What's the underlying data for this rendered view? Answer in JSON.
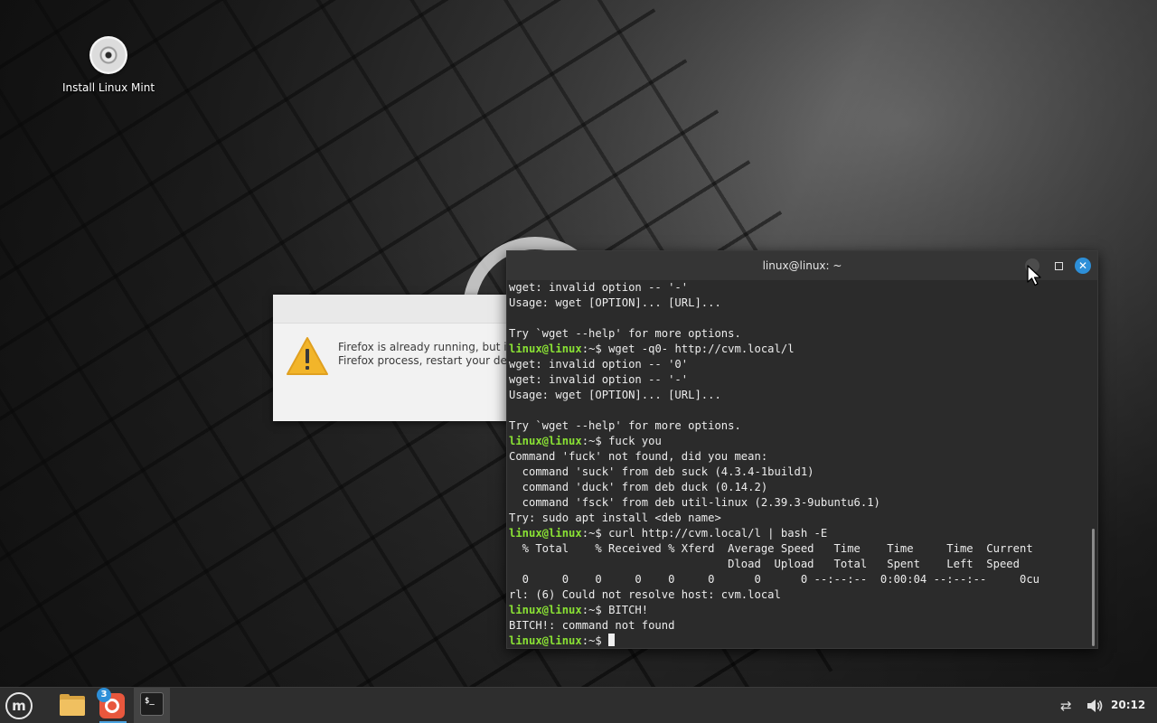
{
  "desktop": {
    "icons": [
      {
        "label": "Install Linux Mint",
        "icon": "disc-icon"
      }
    ]
  },
  "firefox_dialog": {
    "icon": "warning-icon",
    "line1": "Firefox is already running, but is",
    "line2": "Firefox process, restart your de"
  },
  "terminal": {
    "title": "linux@linux: ~",
    "prompt_user": "linux@linux",
    "prompt_tail": ":~$ ",
    "lines": [
      {
        "text": "wget: invalid option -- '-'"
      },
      {
        "text": "Usage: wget [OPTION]... [URL]..."
      },
      {
        "text": ""
      },
      {
        "text": "Try `wget --help' for more options."
      },
      {
        "prompt": "linux@linux",
        "text": "wget -q0- http://cvm.local/l"
      },
      {
        "text": "wget: invalid option -- '0'"
      },
      {
        "text": "wget: invalid option -- '-'"
      },
      {
        "text": "Usage: wget [OPTION]... [URL]..."
      },
      {
        "text": ""
      },
      {
        "text": "Try `wget --help' for more options."
      },
      {
        "prompt": "linux@linux",
        "text": "fuck you"
      },
      {
        "text": "Command 'fuck' not found, did you mean:"
      },
      {
        "text": "  command 'suck' from deb suck (4.3.4-1build1)"
      },
      {
        "text": "  command 'duck' from deb duck (0.14.2)"
      },
      {
        "text": "  command 'fsck' from deb util-linux (2.39.3-9ubuntu6.1)"
      },
      {
        "text": "Try: sudo apt install <deb name>"
      },
      {
        "prompt": "linux@linux",
        "text": "curl http://cvm.local/l | bash -E"
      },
      {
        "text": "  % Total    % Received % Xferd  Average Speed   Time    Time     Time  Current"
      },
      {
        "text": "                                 Dload  Upload   Total   Spent    Left  Speed"
      },
      {
        "text": "  0     0    0     0    0     0      0      0 --:--:--  0:00:04 --:--:--     0cu"
      },
      {
        "text": "rl: (6) Could not resolve host: cvm.local"
      },
      {
        "prompt": "linux@linux",
        "text": "BITCH!"
      },
      {
        "text": "BITCH!: command not found"
      },
      {
        "prompt": "linux@linux",
        "text": "",
        "cursor": true
      }
    ]
  },
  "taskbar": {
    "menu_icon": "mint-menu-icon",
    "apps": [
      {
        "name": "files",
        "icon": "folder-icon"
      },
      {
        "name": "update-manager",
        "icon": "update-manager-icon",
        "badge": "3"
      },
      {
        "name": "terminal",
        "icon": "terminal-icon",
        "glyph": "$_"
      }
    ],
    "tray": {
      "network_icon": "network-icon",
      "volume_icon": "volume-icon"
    },
    "clock": "20:12"
  },
  "colors": {
    "prompt": "#8ae234",
    "accent": "#2d8fd8",
    "update_badge": "#2d8fd8"
  }
}
